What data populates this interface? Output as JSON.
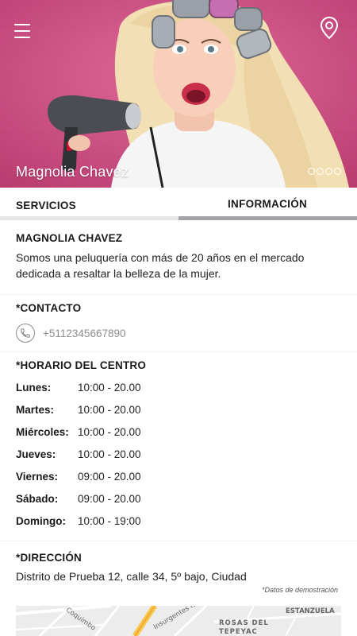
{
  "hero": {
    "title": "Magnolia Chavez",
    "slides": 4,
    "active_slide": 1,
    "accent": "#cc4a80"
  },
  "tabs": [
    {
      "label": "SERVICIOS",
      "active": false
    },
    {
      "label": "INFORMACIÓN",
      "active": true
    }
  ],
  "about": {
    "name": "MAGNOLIA CHAVEZ",
    "description": "Somos una peluquería con más de 20 años en el mercado dedicada a resaltar la belleza de la mujer."
  },
  "contact": {
    "heading": "*CONTACTO",
    "phone": "+5112345667890"
  },
  "schedule": {
    "heading": "*HORARIO DEL CENTRO",
    "rows": [
      {
        "day": "Lunes:",
        "time": "10:00 - 20.00"
      },
      {
        "day": "Martes:",
        "time": "10:00 - 20.00"
      },
      {
        "day": "Miércoles:",
        "time": "10:00 - 20.00"
      },
      {
        "day": "Jueves:",
        "time": "10:00 - 20.00"
      },
      {
        "day": "Viernes:",
        "time": "09:00 - 20.00"
      },
      {
        "day": "Sábado:",
        "time": "09:00 - 20.00"
      },
      {
        "day": "Domingo:",
        "time": "10:00 - 19:00"
      }
    ]
  },
  "address": {
    "heading": "*DIRECCIÓN",
    "text": "Distrito de Prueba 12, calle 34, 5º bajo, Ciudad",
    "note": "*Datos de demostración"
  },
  "map": {
    "labels": [
      "Coquimbo",
      "Insurgentes Nte",
      "ESTANZUELA",
      "ROSAS DEL",
      "TEPEYAC"
    ]
  }
}
